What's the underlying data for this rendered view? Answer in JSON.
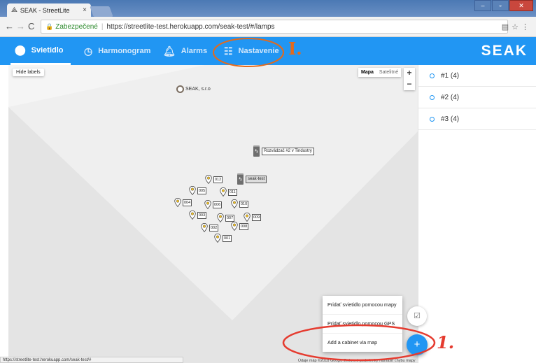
{
  "browser": {
    "tab_title": "SEAK - StreetLite",
    "tab_close": "×",
    "secure_label": "Zabezpečené",
    "url": "https://streetlite-test.herokuapp.com/seak-test/#/lamps",
    "status_url": "https://streetlite-test.herokuapp.com/seak-test/#"
  },
  "nav": {
    "items": [
      {
        "label": "Svietidlo",
        "icon": "lamp-icon",
        "active": true
      },
      {
        "label": "Harmonogram",
        "icon": "clock-icon",
        "active": false
      },
      {
        "label": "Alarms",
        "icon": "bell-icon",
        "active": false
      },
      {
        "label": "Nastavenie",
        "icon": "sliders-icon",
        "active": false
      }
    ],
    "brand": "SEAK"
  },
  "map": {
    "hide_labels": "Hide labels",
    "map_type_map": "Mapa",
    "map_type_satellite": "Satelitné",
    "zoom_in": "+",
    "zoom_out": "−",
    "company": "SEAK, s.r.o",
    "cabinets": [
      "Rozvádzač #2 v Tindustry",
      "seak-test"
    ],
    "lamps": [
      "012",
      "005",
      "011",
      "004",
      "006",
      "010",
      "003",
      "007",
      "009",
      "002",
      "008",
      "001"
    ],
    "footer": "Údaje máp ©2018 Google   Zmluvné podmienky   Nahlásiť chybu mapy"
  },
  "sidebar": {
    "groups": [
      "#1 (4)",
      "#2 (4)",
      "#3 (4)"
    ]
  },
  "fab_menu": {
    "items": [
      "Pridať svietidlo pomocou mapy",
      "Pridať svietidlo pomocou GPS",
      "Add a cabinet via map"
    ],
    "fab_label": "+",
    "small_fab_icon": "checklist-icon"
  },
  "annotations": {
    "one": "1.",
    "two": "I."
  },
  "colors": {
    "primary": "#2196f3",
    "annotation_orange": "#e36a1c",
    "annotation_red": "#e53b2f"
  }
}
